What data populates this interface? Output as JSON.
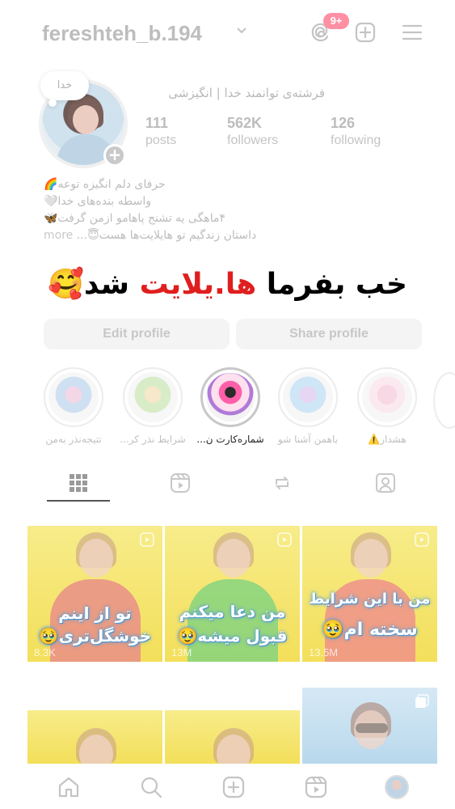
{
  "header": {
    "username": "fereshteh_b.194",
    "notification_count": "9+",
    "icons": [
      "chevron-down-icon",
      "threads-icon",
      "plus-square-icon",
      "menu-icon"
    ]
  },
  "profile": {
    "note": "خدا",
    "full_name": "فرشته‌ی توانمند خدا | انگیزشی",
    "stats": [
      {
        "value": "111",
        "label": "posts"
      },
      {
        "value": "562K",
        "label": "followers"
      },
      {
        "value": "126",
        "label": "following"
      }
    ],
    "bio_lines": [
      "حرفای دلم انگیزه توعه🌈",
      "واسطه بنده‌های خدا🤍",
      "۴ماهگی یه تشنج پاهامو ازمن گرفت🦋",
      "داستان زندگیم تو هایلایت‌ها هست😇..."
    ],
    "bio_more": "more",
    "overlay_caption": {
      "part1": "خب بفرما ",
      "part2": "ها.یلایت",
      "part3": " شد🥰"
    },
    "buttons": {
      "edit": "Edit profile",
      "share": "Share profile"
    }
  },
  "highlights": [
    {
      "label": "تتیجه‌نذر به‌من",
      "active": false
    },
    {
      "label": "شرایط نذر کر...",
      "active": false
    },
    {
      "label": "شماره‌کارت ن...",
      "active": true
    },
    {
      "label": "باهمن آشنا شو",
      "active": false
    },
    {
      "label": "هشدار⚠️",
      "active": false
    }
  ],
  "tabs": [
    "grid-icon",
    "reels-icon",
    "reposts-icon",
    "tagged-icon"
  ],
  "posts": [
    {
      "text1": "تو از اینم",
      "text2": "خوشگل‌تری🥹",
      "views": "8.3K",
      "color": "#f6e36c"
    },
    {
      "text1": "من دعا میکنم",
      "text2": "قبول میشه🥹",
      "views": "13M",
      "color": "#f6e36c"
    },
    {
      "text1": "من با این شرایط",
      "text2": "سخته ام🥹",
      "views": "13.5M",
      "color": "#f6e36c"
    },
    {
      "text1": "",
      "text2": "",
      "views": "",
      "color": "#f6e36c"
    },
    {
      "text1": "",
      "text2": "",
      "views": "",
      "color": "#f6e36c"
    },
    {
      "text1": "",
      "text2": "",
      "views": "",
      "color": "#cfe4f2"
    }
  ],
  "bottom_nav": [
    "home-icon",
    "search-icon",
    "create-icon",
    "reels-icon",
    "profile-avatar"
  ]
}
